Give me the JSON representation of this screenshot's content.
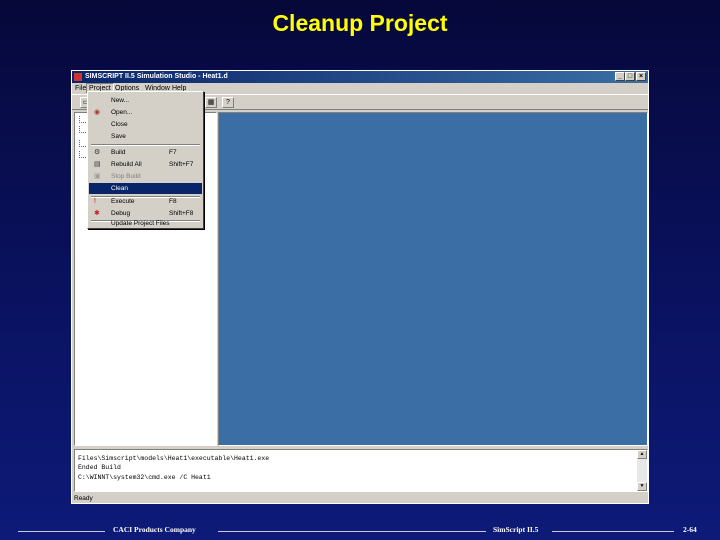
{
  "slide": {
    "title": "Cleanup Project"
  },
  "window": {
    "title": "SIMSCRIPT II.5 Simulation Studio - Heat1.d",
    "buttons": [
      "_",
      "□",
      "×"
    ]
  },
  "menubar": {
    "items": [
      "File",
      "Project",
      "Options",
      "Window",
      "Help"
    ]
  },
  "file_menu": {
    "items": [
      {
        "label": "New...",
        "shortcut": "",
        "icon": ""
      },
      {
        "label": "Open...",
        "shortcut": "",
        "icon": "open-icon"
      },
      {
        "label": "Close",
        "shortcut": "",
        "icon": ""
      },
      {
        "label": "Save",
        "shortcut": "",
        "icon": ""
      },
      {
        "label": "Build",
        "shortcut": "F7",
        "icon": "build-icon"
      },
      {
        "label": "Rebuild All",
        "shortcut": "Shift+F7",
        "icon": "rebuild-icon"
      },
      {
        "label": "Stop Build",
        "shortcut": "",
        "icon": "stop-icon"
      },
      {
        "label": "Clean",
        "shortcut": "",
        "icon": ""
      },
      {
        "label": "Execute",
        "shortcut": "F8",
        "icon": "execute-icon"
      },
      {
        "label": "Debug",
        "shortcut": "Shift+F8",
        "icon": "debug-icon"
      },
      {
        "label": "Update Project Files",
        "shortcut": "",
        "icon": ""
      }
    ],
    "selected": "Clean",
    "disabled": "Stop Build"
  },
  "output": {
    "lines": [
      "Files\\Simscript\\models\\Heat1\\executable\\Heat1.exe",
      "Ended Build",
      "C:\\WINNT\\system32\\cmd.exe /C Heat1"
    ]
  },
  "status": {
    "text": "Ready"
  },
  "footer": {
    "left": "CACI Products Company",
    "center": "SimScript II.5",
    "page": "2-64"
  },
  "colors": {
    "title": "#ffff00",
    "workspace": "#3a6ea5",
    "menu_highlight": "#0a246a"
  }
}
